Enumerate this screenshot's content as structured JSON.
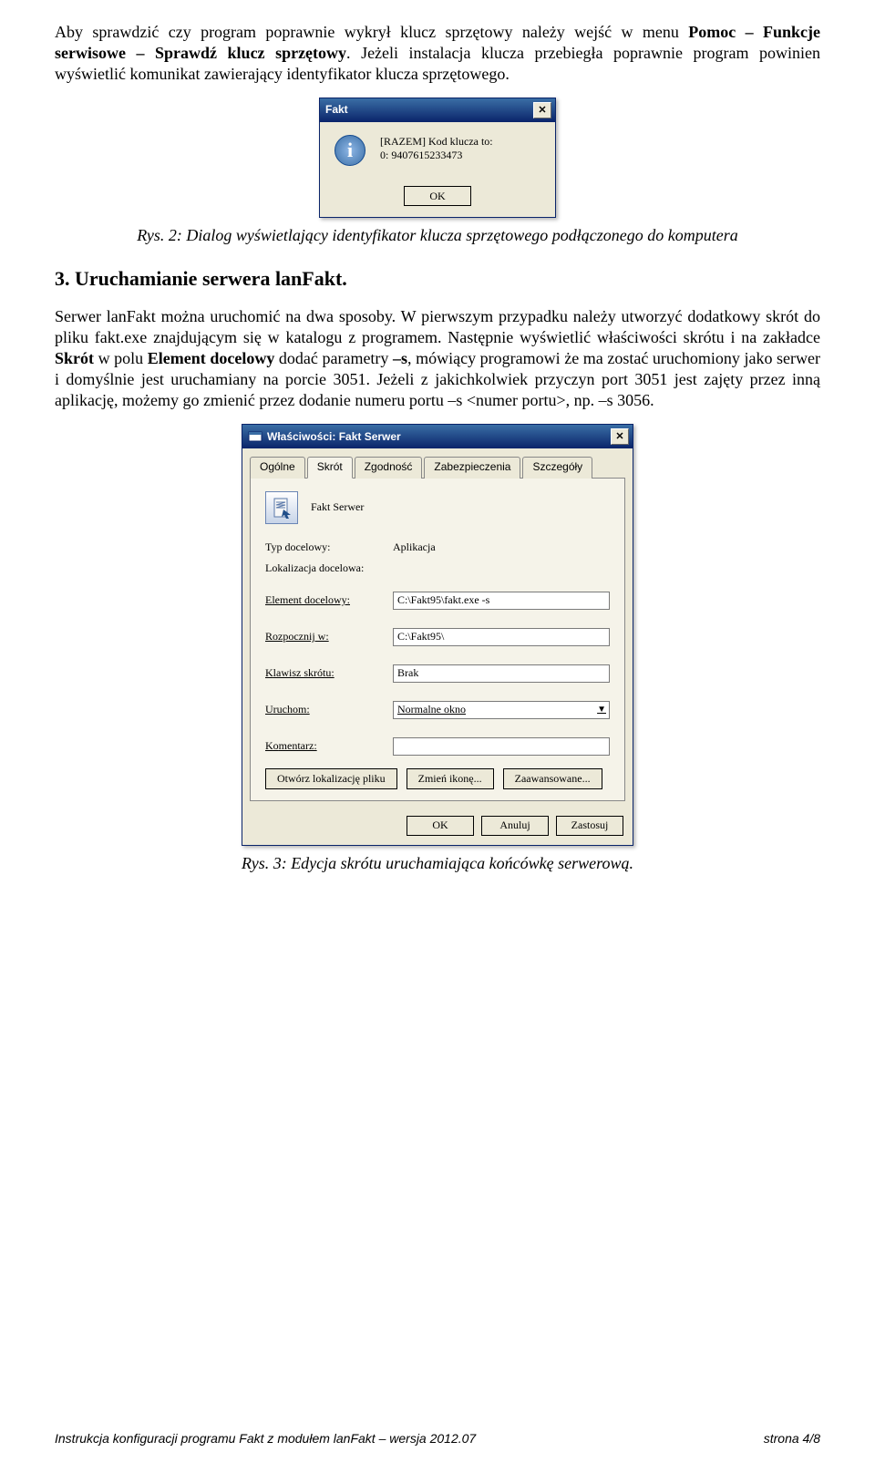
{
  "intro_html": "Aby sprawdzić czy program poprawnie wykrył klucz sprzętowy należy wejść w menu {b}Pomoc – Funkcje serwisowe – Sprawdź klucz sprzętowy{/b}. Jeżeli instalacja klucza przebiegła poprawnie program powinien wyświetlić komunikat zawierający identyfikator klucza sprzętowego.",
  "dialog1": {
    "title": "Fakt",
    "text": "[RAZEM] Kod klucza to:\n0: 9407615233473",
    "ok": "OK"
  },
  "caption1": "Rys. 2: Dialog wyświetlający identyfikator klucza sprzętowego podłączonego do komputera",
  "heading3": "3. Uruchamianie serwera lanFakt.",
  "para2_html": "Serwer lanFakt można uruchomić na dwa sposoby. W pierwszym przypadku należy utworzyć dodatkowy skrót do pliku fakt.exe znajdującym się w katalogu z programem. Następnie wyświetlić właściwości skrótu i na zakładce {b}Skrót{/b} w polu {b}Element docelowy{/b} dodać parametry {b}–s{/b}, mówiący programowi że ma zostać uruchomiony jako serwer i domyślnie jest uruchamiany na porcie 3051. Jeżeli z jakichkolwiek przyczyn port 3051 jest zajęty przez inną aplikację, możemy go zmienić przez dodanie numeru portu –s <numer portu>, np. –s 3056.",
  "dialog2": {
    "title": "Właściwości: Fakt Serwer",
    "tabs": [
      "Ogólne",
      "Skrót",
      "Zgodność",
      "Zabezpieczenia",
      "Szczegóły"
    ],
    "active_tab": 1,
    "name": "Fakt Serwer",
    "rows": {
      "target_type_label": "Typ docelowy:",
      "target_type_value": "Aplikacja",
      "target_loc_label": "Lokalizacja docelowa:",
      "target_loc_value": "",
      "target_label": "Element docelowy:",
      "target_value": "C:\\Fakt95\\fakt.exe -s",
      "start_in_label": "Rozpocznij w:",
      "start_in_value": "C:\\Fakt95\\",
      "shortcut_key_label": "Klawisz skrótu:",
      "shortcut_key_value": "Brak",
      "run_label": "Uruchom:",
      "run_value": "Normalne okno",
      "comment_label": "Komentarz:",
      "comment_value": ""
    },
    "btn_open_loc": "Otwórz lokalizację pliku",
    "btn_change_icon": "Zmień ikonę...",
    "btn_advanced": "Zaawansowane...",
    "ok": "OK",
    "cancel": "Anuluj",
    "apply": "Zastosuj"
  },
  "caption2": "Rys. 3: Edycja skrótu uruchamiająca końcówkę serwerową.",
  "footer_left": "Instrukcja konfiguracji programu Fakt z modułem lanFakt – wersja 2012.07",
  "footer_right": "strona 4/8"
}
